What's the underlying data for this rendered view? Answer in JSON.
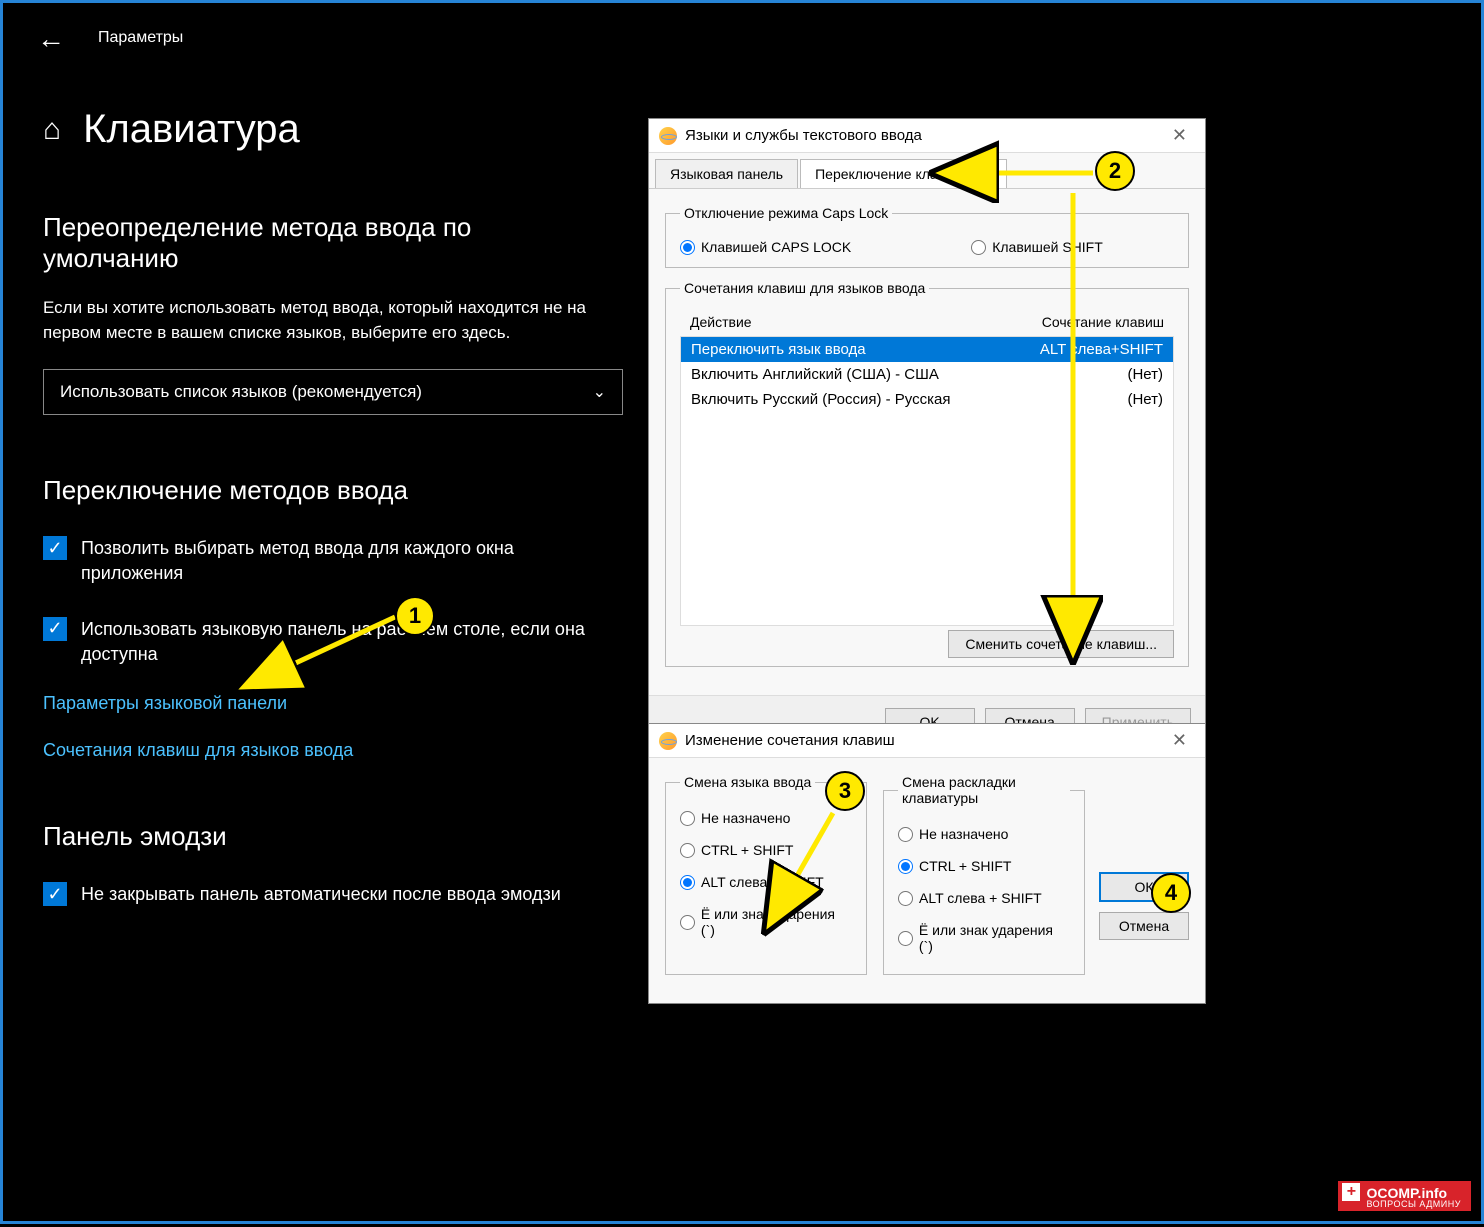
{
  "settings": {
    "breadcrumb": "Параметры",
    "title": "Клавиатура",
    "section1_h": "Переопределение метода ввода по умолчанию",
    "section1_p": "Если вы хотите использовать метод ввода, который находится не на первом месте в вашем списке языков, выберите его здесь.",
    "dropdown": "Использовать список языков (рекомендуется)",
    "section2_h": "Переключение методов ввода",
    "chk1": "Позволить выбирать метод ввода для каждого окна приложения",
    "chk2": "Использовать языковую панель на рабочем столе, если она доступна",
    "link1": "Параметры языковой панели",
    "link2": "Сочетания клавиш для языков ввода",
    "section3_h": "Панель эмодзи",
    "chk3": "Не закрывать панель автоматически после ввода эмодзи"
  },
  "d1": {
    "title": "Языки и службы текстового ввода",
    "tab1": "Языковая панель",
    "tab2": "Переключение клавиатуры",
    "caps_legend": "Отключение режима Caps Lock",
    "caps_opt1": "Клавишей CAPS LOCK",
    "caps_opt2": "Клавишей SHIFT",
    "hot_legend": "Сочетания клавиш для языков ввода",
    "col_action": "Действие",
    "col_hotkey": "Сочетание клавиш",
    "rows": [
      {
        "action": "Переключить язык ввода",
        "hotkey": "ALT слева+SHIFT",
        "sel": true
      },
      {
        "action": "Включить Английский (США) - США",
        "hotkey": "(Нет)"
      },
      {
        "action": "Включить Русский (Россия) - Русская",
        "hotkey": "(Нет)"
      }
    ],
    "change_btn": "Сменить сочетание клавиш...",
    "ok": "OK",
    "cancel": "Отмена",
    "apply": "Применить"
  },
  "d2": {
    "title": "Изменение сочетания клавиш",
    "g1_legend": "Смена языка ввода",
    "g2_legend": "Смена раскладки клавиатуры",
    "opt_none": "Не назначено",
    "opt_ctrl": "CTRL + SHIFT",
    "opt_alt": "ALT слева + SHIFT",
    "opt_e": "Ё или знак ударения (`)",
    "ok": "ОК",
    "cancel": "Отмена"
  },
  "markers": {
    "m1": "1",
    "m2": "2",
    "m3": "3",
    "m4": "4"
  },
  "watermark": {
    "brand": "OCOMP.info",
    "sub": "ВОПРОСЫ АДМИНУ"
  }
}
